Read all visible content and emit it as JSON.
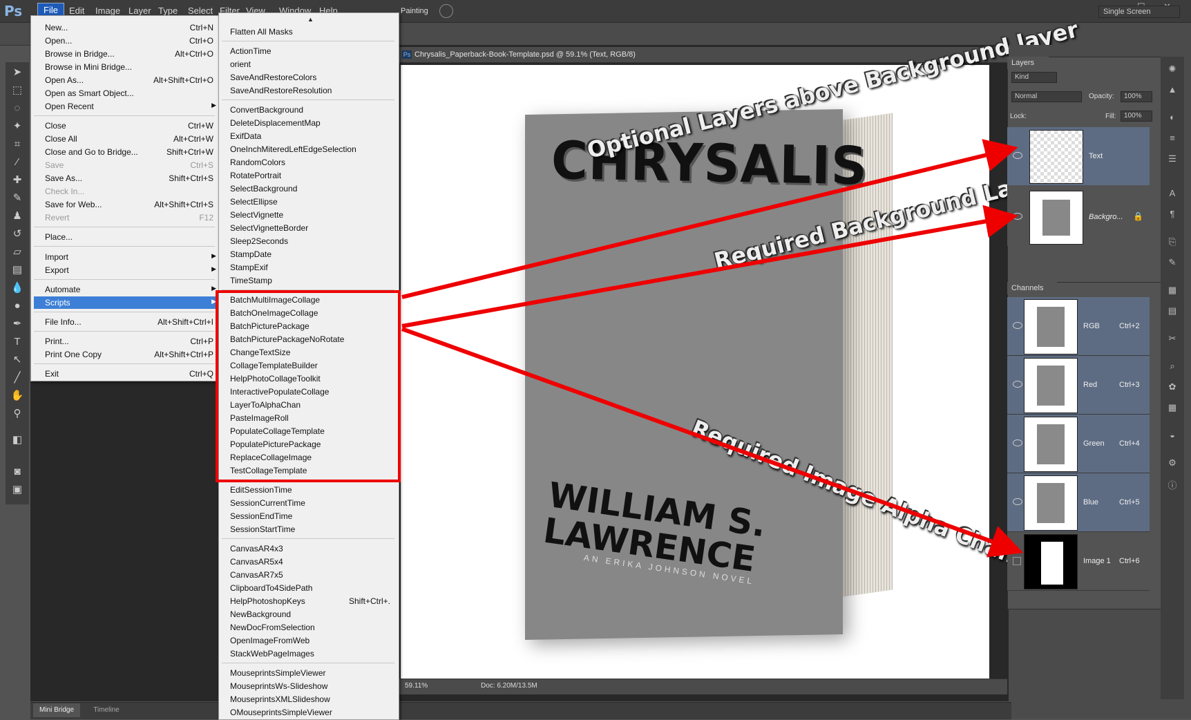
{
  "app": {
    "logo": "Ps"
  },
  "menubar": [
    "File",
    "Edit",
    "Image",
    "Layer",
    "Type",
    "Select",
    "Filter",
    "View",
    "Window",
    "Help"
  ],
  "window_controls": [
    "–",
    "☐",
    "✕"
  ],
  "options_bar": {
    "mode_label": "Painting",
    "screen_mode": "Single Screen"
  },
  "document": {
    "title": "Chrysalis_Paperback-Book-Template.psd @ 59.1% (Text, RGB/8)",
    "zoom": "59.11%",
    "doc_size": "Doc: 6.20M/13.5M"
  },
  "book": {
    "title": "CHRYSALIS",
    "author_line1": "WILLIAM S.",
    "author_line2": "LAWRENCE",
    "subtitle": "AN ERIKA JOHNSON NOVEL"
  },
  "annotations": {
    "optional": "Optional Layers above Background layer",
    "background": "Required Background Layer",
    "alpha": "Required Image Alpha Channel",
    "accent_color": "#ee0000"
  },
  "file_menu": [
    {
      "label": "New...",
      "shortcut": "Ctrl+N"
    },
    {
      "label": "Open...",
      "shortcut": "Ctrl+O"
    },
    {
      "label": "Browse in Bridge...",
      "shortcut": "Alt+Ctrl+O"
    },
    {
      "label": "Browse in Mini Bridge...",
      "shortcut": ""
    },
    {
      "label": "Open As...",
      "shortcut": "Alt+Shift+Ctrl+O"
    },
    {
      "label": "Open as Smart Object...",
      "shortcut": ""
    },
    {
      "label": "Open Recent",
      "shortcut": ""
    },
    {
      "label": "Close",
      "shortcut": "Ctrl+W"
    },
    {
      "label": "Close All",
      "shortcut": "Alt+Ctrl+W"
    },
    {
      "label": "Close and Go to Bridge...",
      "shortcut": "Shift+Ctrl+W"
    },
    {
      "label": "Save",
      "shortcut": "Ctrl+S"
    },
    {
      "label": "Save As...",
      "shortcut": "Shift+Ctrl+S"
    },
    {
      "label": "Check In...",
      "shortcut": ""
    },
    {
      "label": "Save for Web...",
      "shortcut": "Alt+Shift+Ctrl+S"
    },
    {
      "label": "Revert",
      "shortcut": "F12"
    },
    {
      "label": "Place...",
      "shortcut": ""
    },
    {
      "label": "Import",
      "shortcut": ""
    },
    {
      "label": "Export",
      "shortcut": ""
    },
    {
      "label": "Automate",
      "shortcut": ""
    },
    {
      "label": "Scripts",
      "shortcut": ""
    },
    {
      "label": "File Info...",
      "shortcut": "Alt+Shift+Ctrl+I"
    },
    {
      "label": "Print...",
      "shortcut": "Ctrl+P"
    },
    {
      "label": "Print One Copy",
      "shortcut": "Alt+Shift+Ctrl+P"
    },
    {
      "label": "Exit",
      "shortcut": "Ctrl+Q"
    }
  ],
  "scripts_menu": [
    "Flatten All Masks",
    "ActionTime",
    "orient",
    "SaveAndRestoreColors",
    "SaveAndRestoreResolution",
    "ConvertBackground",
    "DeleteDisplacementMap",
    "ExifData",
    "OneInchMiteredLeftEdgeSelection",
    "RandomColors",
    "RotatePortrait",
    "SelectBackground",
    "SelectEllipse",
    "SelectVignette",
    "SelectVignetteBorder",
    "Sleep2Seconds",
    "StampDate",
    "StampExif",
    "TimeStamp",
    "BatchMultiImageCollage",
    "BatchOneImageCollage",
    "BatchPicturePackage",
    "BatchPicturePackageNoRotate",
    "ChangeTextSize",
    "CollageTemplateBuilder",
    "HelpPhotoCollageToolkit",
    "InteractivePopulateCollage",
    "LayerToAlphaChan",
    "PasteImageRoll",
    "PopulateCollageTemplate",
    "PopulatePicturePackage",
    "ReplaceCollageImage",
    "TestCollageTemplate",
    "EditSessionTime",
    "SessionCurrentTime",
    "SessionEndTime",
    "SessionStartTime",
    "CanvasAR4x3",
    "CanvasAR5x4",
    "CanvasAR7x5",
    "ClipboardTo4SidePath",
    "HelpPhotoshopKeys",
    "NewBackground",
    "NewDocFromSelection",
    "OpenImageFromWeb",
    "StackWebPageImages",
    "MouseprintsSimpleViewer",
    "MouseprintsWs-Slideshow",
    "MouseprintsXMLSlideshow",
    "OMouseprintsSimpleViewer"
  ],
  "scripts_shortcut_helpkeys": "Shift+Ctrl+.",
  "layers_panel": {
    "tab": "Layers",
    "filter": "Kind",
    "blend": "Normal",
    "opacity_label": "Opacity:",
    "opacity": "100%",
    "lock_label": "Lock:",
    "fill_label": "Fill:",
    "fill": "100%",
    "layers": [
      {
        "name": "Text"
      },
      {
        "name": "Backgro..."
      }
    ]
  },
  "channels_panel": {
    "tab": "Channels",
    "channels": [
      {
        "name": "RGB",
        "shortcut": "Ctrl+2"
      },
      {
        "name": "Red",
        "shortcut": "Ctrl+3"
      },
      {
        "name": "Green",
        "shortcut": "Ctrl+4"
      },
      {
        "name": "Blue",
        "shortcut": "Ctrl+5"
      },
      {
        "name": "Image 1",
        "shortcut": "Ctrl+6"
      }
    ]
  },
  "bottom_tabs": {
    "mini_bridge": "Mini Bridge",
    "timeline": "Timeline"
  }
}
